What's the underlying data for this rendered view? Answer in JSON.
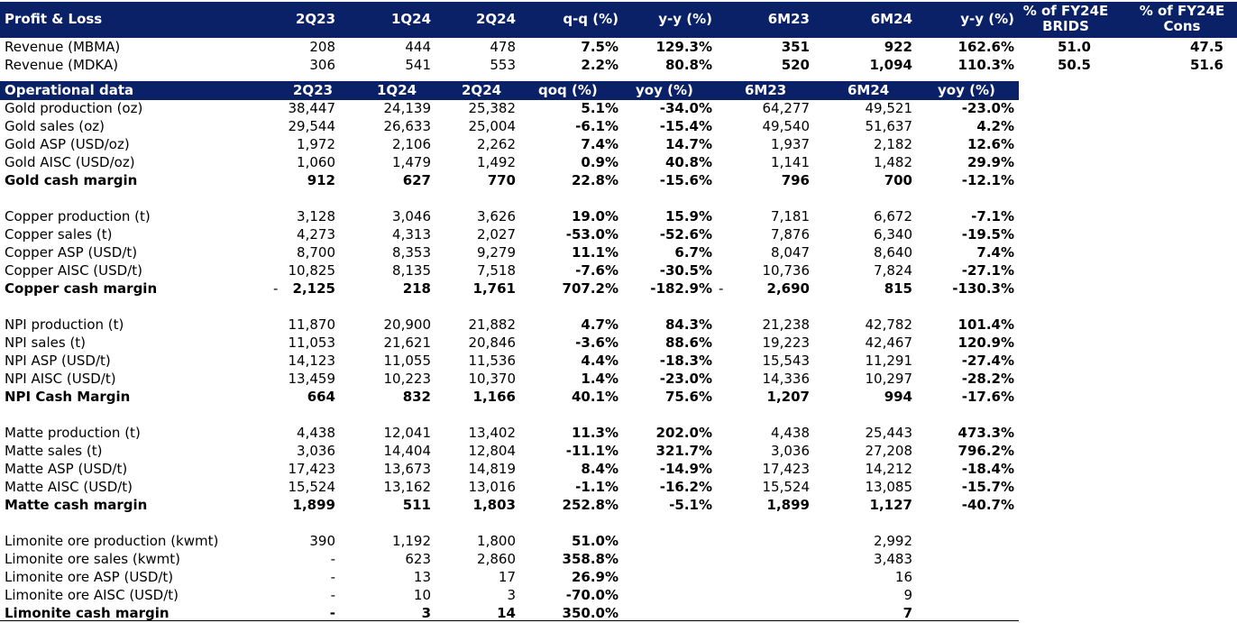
{
  "pl": {
    "headers": [
      "Profit & Loss",
      "2Q23",
      "1Q24",
      "2Q24",
      "q-q (%)",
      "y-y (%)",
      "6M23",
      "6M24",
      "y-y (%)",
      "% of FY24E BRIDS",
      "% of FY24E Cons"
    ],
    "rows": [
      {
        "label": "Revenue (MBMA)",
        "v": [
          "208",
          "444",
          "478",
          "7.5%",
          "129.3%",
          "351",
          "922",
          "162.6%",
          "51.0",
          "47.5"
        ]
      },
      {
        "label": "Revenue (MDKA)",
        "v": [
          "306",
          "541",
          "553",
          "2.2%",
          "80.8%",
          "520",
          "1,094",
          "110.3%",
          "50.5",
          "51.6"
        ]
      }
    ]
  },
  "ops": {
    "headers": [
      "Operational data",
      "2Q23",
      "1Q24",
      "2Q24",
      "qoq (%)",
      "yoy (%)",
      "6M23",
      "6M24",
      "yoy (%)"
    ],
    "rows": [
      {
        "label": "Gold production (oz)",
        "bold": false,
        "v": [
          "38,447",
          "24,139",
          "25,382",
          "5.1%",
          "-34.0%",
          "64,277",
          "49,521",
          "-23.0%"
        ]
      },
      {
        "label": "Gold sales (oz)",
        "bold": false,
        "v": [
          "29,544",
          "26,633",
          "25,004",
          "-6.1%",
          "-15.4%",
          "49,540",
          "51,637",
          "4.2%"
        ]
      },
      {
        "label": "Gold ASP (USD/oz)",
        "bold": false,
        "v": [
          "1,972",
          "2,106",
          "2,262",
          "7.4%",
          "14.7%",
          "1,937",
          "2,182",
          "12.6%"
        ]
      },
      {
        "label": "Gold AISC (USD/oz)",
        "bold": false,
        "v": [
          "1,060",
          "1,479",
          "1,492",
          "0.9%",
          "40.8%",
          "1,141",
          "1,482",
          "29.9%"
        ]
      },
      {
        "label": "Gold cash margin",
        "bold": true,
        "v": [
          "912",
          "627",
          "770",
          "22.8%",
          "-15.6%",
          "796",
          "700",
          "-12.1%"
        ]
      },
      {
        "label": "Copper production (t)",
        "bold": false,
        "v": [
          "3,128",
          "3,046",
          "3,626",
          "19.0%",
          "15.9%",
          "7,181",
          "6,672",
          "-7.1%"
        ]
      },
      {
        "label": "Copper sales (t)",
        "bold": false,
        "v": [
          "4,273",
          "4,313",
          "2,027",
          "-53.0%",
          "-52.6%",
          "7,876",
          "6,340",
          "-19.5%"
        ]
      },
      {
        "label": "Copper ASP (USD/t)",
        "bold": false,
        "v": [
          "8,700",
          "8,353",
          "9,279",
          "11.1%",
          "6.7%",
          "8,047",
          "8,640",
          "7.4%"
        ]
      },
      {
        "label": "Copper AISC (USD/t)",
        "bold": false,
        "v": [
          "10,825",
          "8,135",
          "7,518",
          "-7.6%",
          "-30.5%",
          "10,736",
          "7,824",
          "-27.1%"
        ]
      },
      {
        "label": "Copper cash margin",
        "bold": true,
        "v": [
          "2,125",
          "218",
          "1,761",
          "707.2%",
          "-182.9%",
          "2,690",
          "815",
          "-130.3%"
        ]
      },
      {
        "label": "NPI production (t)",
        "bold": false,
        "v": [
          "11,870",
          "20,900",
          "21,882",
          "4.7%",
          "84.3%",
          "21,238",
          "42,782",
          "101.4%"
        ]
      },
      {
        "label": "NPI sales (t)",
        "bold": false,
        "v": [
          "11,053",
          "21,621",
          "20,846",
          "-3.6%",
          "88.6%",
          "19,223",
          "42,467",
          "120.9%"
        ]
      },
      {
        "label": "NPI ASP (USD/t)",
        "bold": false,
        "v": [
          "14,123",
          "11,055",
          "11,536",
          "4.4%",
          "-18.3%",
          "15,543",
          "11,291",
          "-27.4%"
        ]
      },
      {
        "label": "NPI AISC (USD/t)",
        "bold": false,
        "v": [
          "13,459",
          "10,223",
          "10,370",
          "1.4%",
          "-23.0%",
          "14,336",
          "10,297",
          "-28.2%"
        ]
      },
      {
        "label": "NPI Cash Margin",
        "bold": true,
        "v": [
          "664",
          "832",
          "1,166",
          "40.1%",
          "75.6%",
          "1,207",
          "994",
          "-17.6%"
        ]
      },
      {
        "label": "Matte production (t)",
        "bold": false,
        "v": [
          "4,438",
          "12,041",
          "13,402",
          "11.3%",
          "202.0%",
          "4,438",
          "25,443",
          "473.3%"
        ]
      },
      {
        "label": "Matte sales (t)",
        "bold": false,
        "v": [
          "3,036",
          "14,404",
          "12,804",
          "-11.1%",
          "321.7%",
          "3,036",
          "27,208",
          "796.2%"
        ]
      },
      {
        "label": "Matte ASP (USD/t)",
        "bold": false,
        "v": [
          "17,423",
          "13,673",
          "14,819",
          "8.4%",
          "-14.9%",
          "17,423",
          "14,212",
          "-18.4%"
        ]
      },
      {
        "label": "Matte AISC (USD/t)",
        "bold": false,
        "v": [
          "15,524",
          "13,162",
          "13,016",
          "-1.1%",
          "-16.2%",
          "15,524",
          "13,085",
          "-15.7%"
        ]
      },
      {
        "label": "Matte cash margin",
        "bold": true,
        "v": [
          "1,899",
          "511",
          "1,803",
          "252.8%",
          "-5.1%",
          "1,899",
          "1,127",
          "-40.7%"
        ]
      },
      {
        "label": "Limonite ore production (kwmt)",
        "bold": false,
        "v": [
          "390",
          "1,192",
          "1,800",
          "51.0%",
          "",
          "",
          "2,992",
          ""
        ]
      },
      {
        "label": "Limonite ore sales (kwmt)",
        "bold": false,
        "v": [
          "-",
          "623",
          "2,860",
          "358.8%",
          "",
          "",
          "3,483",
          ""
        ]
      },
      {
        "label": "Limonite ore ASP (USD/t)",
        "bold": false,
        "v": [
          "-",
          "13",
          "17",
          "26.9%",
          "",
          "",
          "16",
          ""
        ]
      },
      {
        "label": "Limonite ore AISC (USD/t)",
        "bold": false,
        "v": [
          "-",
          "10",
          "3",
          "-70.0%",
          "",
          "",
          "9",
          ""
        ]
      },
      {
        "label": "Limonite cash margin",
        "bold": true,
        "v": [
          "-",
          "3",
          "14",
          "350.0%",
          "",
          "",
          "7",
          ""
        ]
      }
    ],
    "copper_margin_dash_2q23": "-",
    "copper_margin_dash_6m23": "-"
  }
}
